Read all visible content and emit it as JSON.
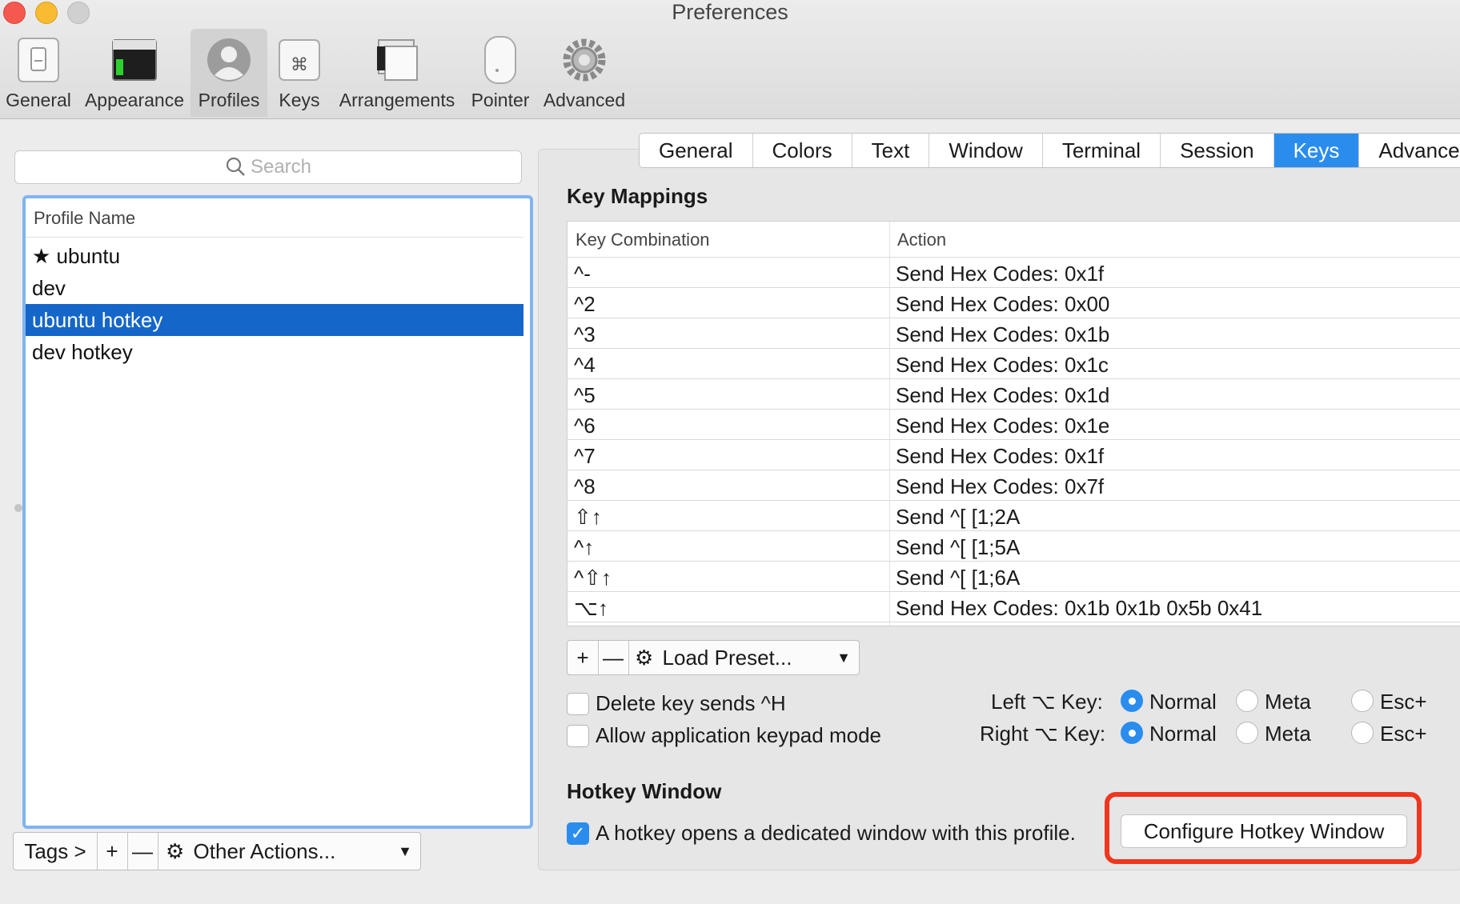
{
  "window": {
    "title": "Preferences"
  },
  "toolbar": {
    "items": [
      {
        "label": "General"
      },
      {
        "label": "Appearance"
      },
      {
        "label": "Profiles"
      },
      {
        "label": "Keys"
      },
      {
        "label": "Arrangements"
      },
      {
        "label": "Pointer"
      },
      {
        "label": "Advanced"
      }
    ],
    "selected": "Profiles"
  },
  "profiles": {
    "search_placeholder": "Search",
    "column_header": "Profile Name",
    "items": [
      {
        "label": "★ ubuntu"
      },
      {
        "label": "dev"
      },
      {
        "label": "ubuntu hotkey"
      },
      {
        "label": "dev hotkey"
      }
    ],
    "selected": "ubuntu hotkey",
    "bottom_bar": {
      "tags": "Tags >",
      "add": "+",
      "remove": "—",
      "other_actions": "Other Actions..."
    }
  },
  "tabs": {
    "items": [
      {
        "label": "General"
      },
      {
        "label": "Colors"
      },
      {
        "label": "Text"
      },
      {
        "label": "Window"
      },
      {
        "label": "Terminal"
      },
      {
        "label": "Session"
      },
      {
        "label": "Keys"
      },
      {
        "label": "Advanced"
      }
    ],
    "active": "Keys"
  },
  "key_mappings": {
    "title": "Key Mappings",
    "columns": [
      "Key Combination",
      "Action"
    ],
    "rows": [
      {
        "key": "^-",
        "action": "Send Hex Codes: 0x1f"
      },
      {
        "key": "^2",
        "action": "Send Hex Codes: 0x00"
      },
      {
        "key": "^3",
        "action": "Send Hex Codes: 0x1b"
      },
      {
        "key": "^4",
        "action": "Send Hex Codes: 0x1c"
      },
      {
        "key": "^5",
        "action": "Send Hex Codes: 0x1d"
      },
      {
        "key": "^6",
        "action": "Send Hex Codes: 0x1e"
      },
      {
        "key": "^7",
        "action": "Send Hex Codes: 0x1f"
      },
      {
        "key": "^8",
        "action": "Send Hex Codes: 0x7f"
      },
      {
        "key": "⇧↑",
        "action": "Send ^[ [1;2A"
      },
      {
        "key": "^↑",
        "action": "Send ^[ [1;5A"
      },
      {
        "key": "^⇧↑",
        "action": "Send ^[ [1;6A"
      },
      {
        "key": "⌥↑",
        "action": "Send Hex Codes: 0x1b 0x1b 0x5b 0x41"
      }
    ],
    "add": "+",
    "remove": "—",
    "load_preset": "Load Preset..."
  },
  "options": {
    "delete_key": {
      "label": "Delete key sends ^H",
      "checked": false
    },
    "keypad_mode": {
      "label": "Allow application keypad mode",
      "checked": false
    },
    "left_option": {
      "label": "Left ⌥ Key:",
      "choices": [
        "Normal",
        "Meta",
        "Esc+"
      ],
      "selected": "Normal"
    },
    "right_option": {
      "label": "Right ⌥ Key:",
      "choices": [
        "Normal",
        "Meta",
        "Esc+"
      ],
      "selected": "Normal"
    }
  },
  "hotkey": {
    "title": "Hotkey Window",
    "checkbox_label": "A hotkey opens a dedicated window with this profile.",
    "checked": true,
    "button_label": "Configure Hotkey Window"
  },
  "colors": {
    "accent": "#2a8dee",
    "selection": "#1466c9",
    "highlight": "#f0361e"
  }
}
